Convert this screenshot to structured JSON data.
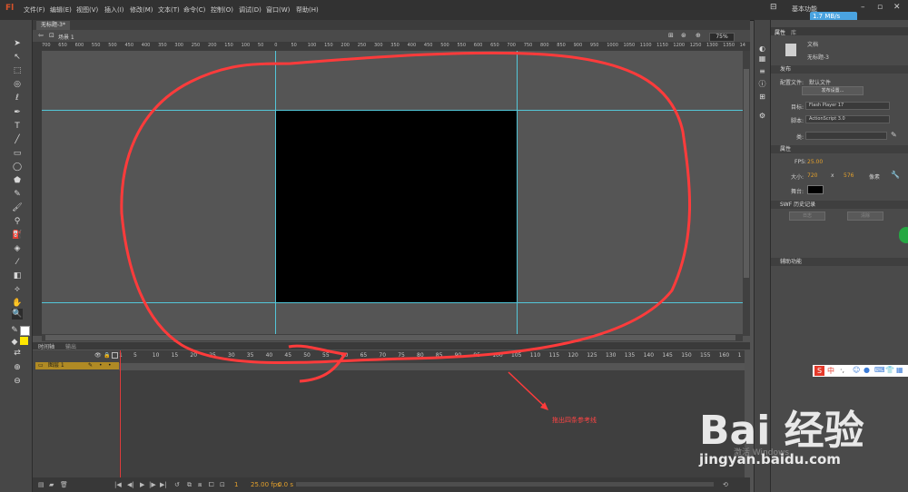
{
  "app": {
    "logo": "Fl"
  },
  "menu": [
    "文件(F)",
    "编辑(E)",
    "视图(V)",
    "插入(I)",
    "修改(M)",
    "文本(T)",
    "命令(C)",
    "控制(O)",
    "调试(D)",
    "窗口(W)",
    "帮助(H)"
  ],
  "workspace_label": "基本功能",
  "network_speed": "1.7 MB/s",
  "document": {
    "tab_title": "无标题-3*",
    "scene": "场景 1",
    "zoom": "75%"
  },
  "ruler": {
    "horizontal": [
      "700",
      "650",
      "600",
      "550",
      "500",
      "450",
      "400",
      "350",
      "300",
      "250",
      "200",
      "150",
      "100",
      "50",
      "0",
      "50",
      "100",
      "150",
      "200",
      "250",
      "300",
      "350",
      "400",
      "450",
      "500",
      "550",
      "600",
      "650",
      "700",
      "750",
      "800",
      "850",
      "900",
      "950",
      "1000",
      "1050",
      "1100",
      "1150",
      "1200",
      "1250",
      "1300",
      "1350",
      "14"
    ]
  },
  "timeline": {
    "tab": "时间轴",
    "tab2": "输出",
    "layer_name": "图层 1",
    "frames": [
      "1",
      "5",
      "10",
      "15",
      "20",
      "25",
      "30",
      "35",
      "40",
      "45",
      "50",
      "55",
      "60",
      "65",
      "70",
      "75",
      "80",
      "85",
      "90",
      "95",
      "100",
      "105",
      "110",
      "115",
      "120",
      "125",
      "130",
      "135",
      "140",
      "145",
      "150",
      "155",
      "160",
      "1"
    ],
    "fps": "25.00 fps",
    "time": "0.0 s",
    "frame_count": "1"
  },
  "panel": {
    "tabs": [
      "属性",
      "库"
    ],
    "doc_type": "文档",
    "doc_name": "无标题-3",
    "sections": {
      "publish": "发布",
      "properties": "属性",
      "swf_history": "SWF 历史记录",
      "accessibility": "辅助功能"
    },
    "profile_label": "配置文件:",
    "profile_value": "默认文件",
    "publish_settings_btn": "发布设置...",
    "target_label": "目标:",
    "target_value": "Flash Player 17",
    "script_label": "脚本:",
    "script_value": "ActionScript 3.0",
    "class_label": "类:",
    "fps_label": "FPS:",
    "fps_value": "25.00",
    "size_label": "大小:",
    "width": "720",
    "x_sep": "x",
    "height": "576",
    "px_unit": "像素",
    "stage_label": "舞台:",
    "stage_color": "#000000",
    "log_btn": "日志",
    "clear_btn": "清除"
  },
  "annotation": {
    "text": "拖出四条参考线",
    "color": "#ff3b3b"
  },
  "watermark": {
    "logo": "Bai 经验",
    "url": "jingyan.baidu.com",
    "windows": "激活 Windows"
  },
  "colors": {
    "stage": "#000000",
    "guide": "#53c6d8",
    "layer": "#b08a24",
    "playhead": "#e23b3b"
  }
}
